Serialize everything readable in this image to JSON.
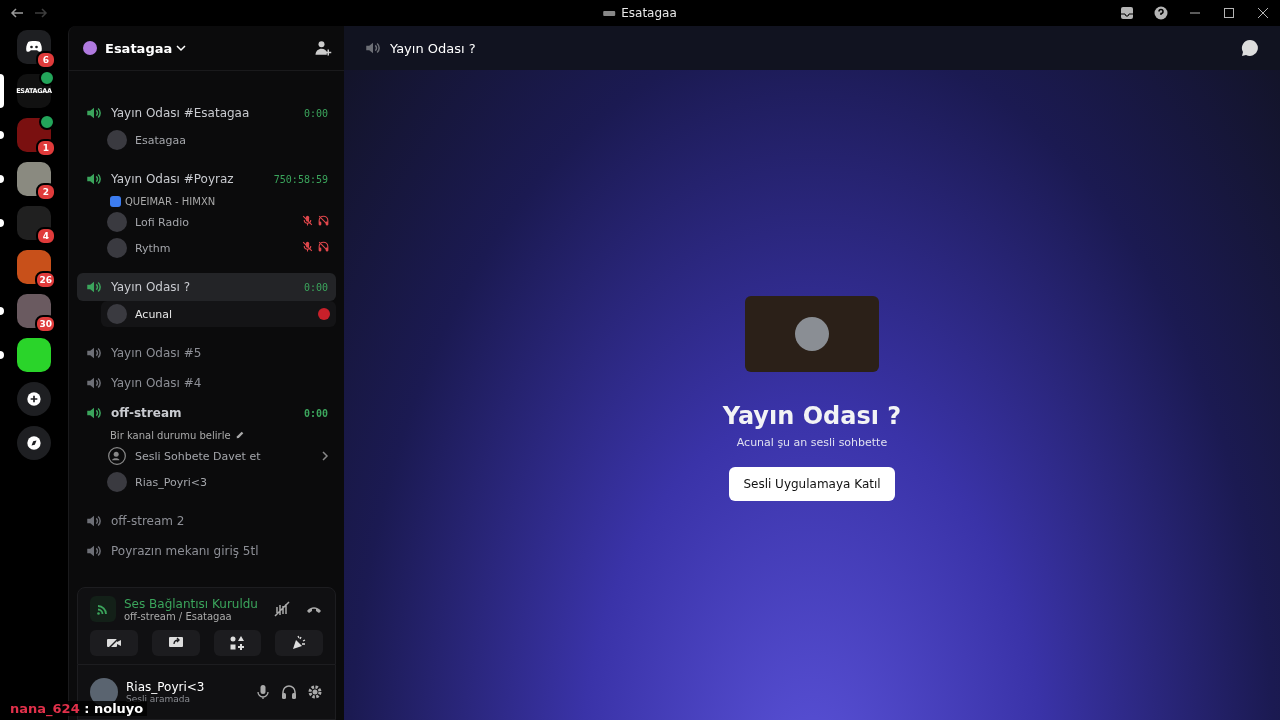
{
  "window": {
    "title": "Esatagaa"
  },
  "servers": [
    {
      "kind": "home",
      "badge": "6",
      "selected": false,
      "unread": false
    },
    {
      "kind": "text-logo",
      "logo_text": "ESATAGAA",
      "selected": true,
      "voice": true
    },
    {
      "kind": "image",
      "color": "#7a1010",
      "badge": "1",
      "selected": false,
      "unread": true,
      "voice": true
    },
    {
      "kind": "image",
      "color": "#8a8a80",
      "badge": "2",
      "selected": false,
      "unread": true
    },
    {
      "kind": "image",
      "color": "#202020",
      "badge": "4",
      "selected": false,
      "unread": true
    },
    {
      "kind": "image",
      "color": "#c8501a",
      "badge": "26",
      "selected": false,
      "unread": false
    },
    {
      "kind": "image",
      "color": "#6a5a60",
      "badge": "30",
      "selected": false,
      "unread": true
    },
    {
      "kind": "image",
      "color": "#2ad42a",
      "selected": false,
      "unread": true
    },
    {
      "kind": "add"
    },
    {
      "kind": "explore"
    }
  ],
  "server_header": {
    "name": "Esatagaa"
  },
  "channels": [
    {
      "name": "Yayın Odası #Esatagaa",
      "active": true,
      "selected": false,
      "current": false,
      "timer": "0:00",
      "members": [
        {
          "name": "Esatagaa",
          "muted": false,
          "deafened": false,
          "live": false
        }
      ]
    },
    {
      "name": "Yayın Odası #Poyraz",
      "active": true,
      "selected": false,
      "current": false,
      "timer": "750:58:59",
      "activity": "QUEIMAR - HIMXN",
      "members": [
        {
          "name": "Lofi Radio",
          "muted": true,
          "deafened": true,
          "live": false
        },
        {
          "name": "Rythm",
          "muted": true,
          "deafened": true,
          "live": false
        }
      ]
    },
    {
      "name": "Yayın Odası ?",
      "active": true,
      "selected": true,
      "current": false,
      "timer": "0:00",
      "members": [
        {
          "name": "Acunal",
          "muted": false,
          "deafened": false,
          "live": true
        }
      ]
    },
    {
      "name": "Yayın Odası #5",
      "active": false,
      "selected": false,
      "current": false
    },
    {
      "name": "Yayın Odası #4",
      "active": false,
      "selected": false,
      "current": false
    },
    {
      "name": "off-stream",
      "active": true,
      "selected": false,
      "current": true,
      "timer": "0:00",
      "status": "Bir kanal durumu belirle",
      "invite": "Sesli Sohbete Davet et",
      "members": [
        {
          "name": "Rias_Poyri<3",
          "muted": false,
          "deafened": false,
          "live": false
        }
      ]
    },
    {
      "name": "off-stream 2",
      "active": false,
      "selected": false,
      "current": false
    },
    {
      "name": "Poyrazın mekanı giriş 5tl",
      "active": false,
      "selected": false,
      "current": false
    }
  ],
  "voice_panel": {
    "status": "Ses Bağlantısı Kuruldu",
    "location": "off-stream / Esatagaa"
  },
  "user_panel": {
    "name": "Rias_Poyri<3",
    "status": "Sesli aramada"
  },
  "main": {
    "channel_title": "Yayın Odası ?",
    "heading": "Yayın Odası ?",
    "subtitle": "Acunal şu an sesli sohbette",
    "join_button": "Sesli Uygulamaya Katıl"
  },
  "chat_overlay": {
    "user": "nana_624",
    "message": ": noluyo"
  }
}
